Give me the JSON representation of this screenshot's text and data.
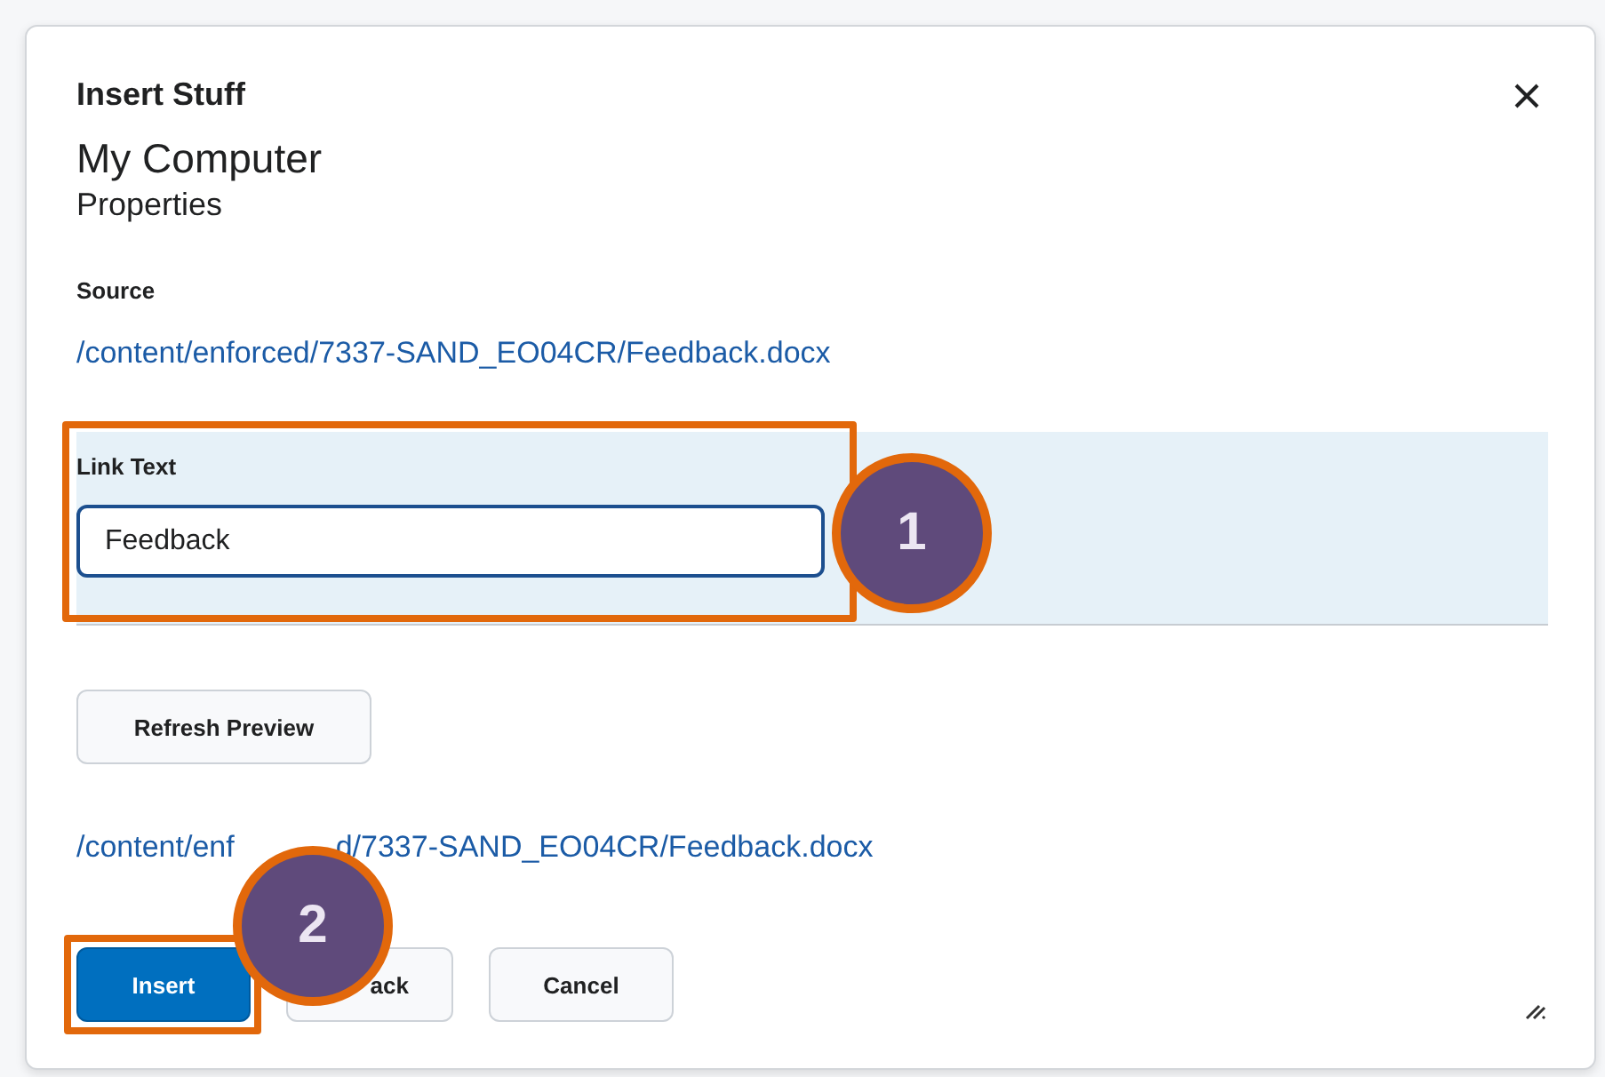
{
  "dialog": {
    "title": "Insert Stuff",
    "heading": "My Computer",
    "subheading": "Properties",
    "source_label": "Source",
    "source_link": "/content/enforced/7337-SAND_EO04CR/Feedback.docx",
    "link_text": {
      "label": "Link Text",
      "value": "Feedback"
    },
    "refresh_button": "Refresh Preview",
    "preview_link_fragments": [
      "/content/enf",
      "d/7337-SAND_EO04CR/Feedback.docx"
    ],
    "buttons": [
      {
        "label": "Insert",
        "kind": "primary"
      },
      {
        "label": "ack",
        "kind": "secondary"
      },
      {
        "label": "Cancel",
        "kind": "secondary"
      }
    ]
  },
  "callouts": [
    {
      "number": "1"
    },
    {
      "number": "2"
    }
  ]
}
